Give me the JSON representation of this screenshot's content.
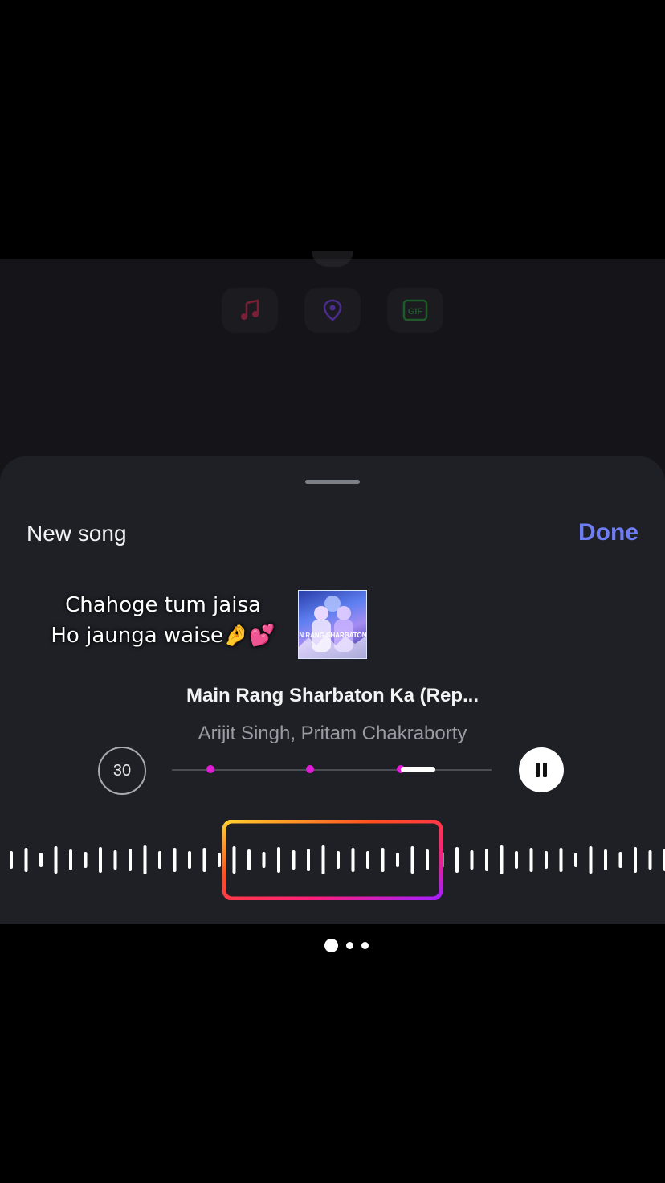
{
  "stickers": {
    "music_icon": "music-note-icon",
    "location_icon": "location-pin-icon",
    "gif_icon": "gif-icon",
    "gif_label": "GIF"
  },
  "sheet": {
    "title": "New song",
    "done_label": "Done"
  },
  "lyrics": {
    "line1": "Chahoge tum jaisa",
    "line2": "Ho jaunga waise🤌💕"
  },
  "album_art": {
    "text": "MAIN RANG SHARBATON KA"
  },
  "song": {
    "title": "Main Rang Sharbaton Ka (Rep...",
    "artist": "Arijit Singh, Pritam Chakraborty"
  },
  "player": {
    "duration": "30",
    "state": "playing",
    "clip_start_fraction": 0.71,
    "clip_end_fraction": 0.82
  },
  "colors": {
    "accent": "#6f7df5",
    "marker": "#e21bd8",
    "sheet_bg": "#1e2026"
  },
  "pager": {
    "count": 3,
    "active": 1
  }
}
